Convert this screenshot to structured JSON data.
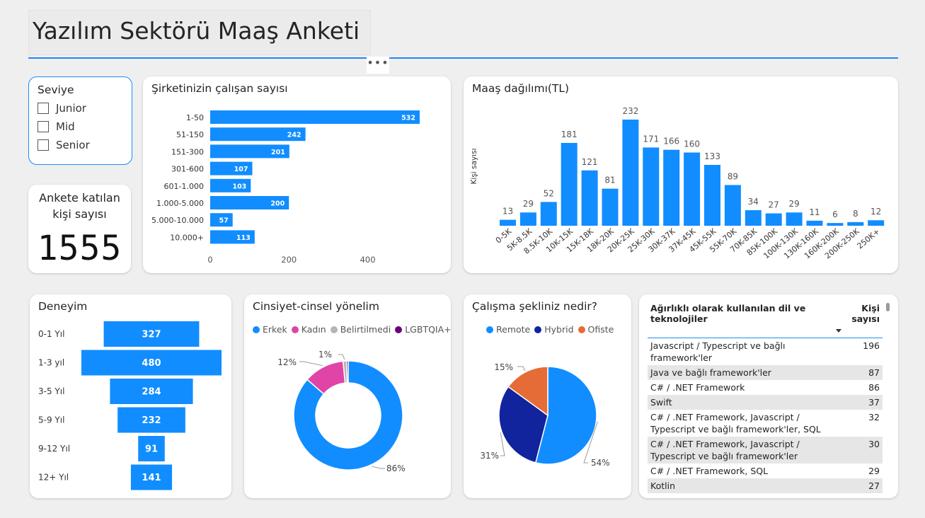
{
  "page_title": "Yazılım Sektörü Maaş Anketi",
  "more_label": "•••",
  "colors": {
    "blue": "#118DFF",
    "navy": "#12239E",
    "orange": "#E66C37",
    "pink": "#E044A7",
    "gray": "#b5b5b5",
    "purple": "#6B007B",
    "accent": "#1e8af5"
  },
  "slicer": {
    "title": "Seviye",
    "items": [
      "Junior",
      "Mid",
      "Senior"
    ]
  },
  "kpi": {
    "label": "Ankete katılan kişi sayısı",
    "value": "1555"
  },
  "chart_data": [
    {
      "id": "company_size",
      "type": "bar",
      "orientation": "horizontal",
      "title": "Şirketinizin çalışan sayısı",
      "categories": [
        "1-50",
        "51-150",
        "151-300",
        "301-600",
        "601-1.000",
        "1.000-5.000",
        "5.000-10.000",
        "10.000+"
      ],
      "values": [
        532,
        242,
        201,
        107,
        103,
        200,
        57,
        113
      ],
      "xticks": [
        0,
        200,
        400
      ],
      "xlim": [
        0,
        500
      ],
      "color": "#118DFF"
    },
    {
      "id": "salary",
      "type": "bar",
      "title": "Maaş dağılımı(TL)",
      "ylabel": "Kişi sayısı",
      "categories": [
        "0-5K",
        "5K-8.5K",
        "8.5K-10K",
        "10K-15K",
        "15K-18K",
        "18K-20K",
        "20K-25K",
        "25K-30K",
        "30K-37K",
        "37K-45K",
        "45K-55K",
        "55K-70K",
        "70K-85K",
        "85K-100K",
        "100K-130K",
        "130K-160K",
        "160K-200K",
        "200K-250K",
        "250K+"
      ],
      "values": [
        13,
        29,
        52,
        181,
        121,
        81,
        232,
        171,
        166,
        160,
        133,
        89,
        34,
        27,
        29,
        11,
        6,
        8,
        12
      ],
      "color": "#118DFF"
    },
    {
      "id": "experience",
      "type": "bar",
      "subtype": "funnel",
      "title": "Deneyim",
      "categories": [
        "0-1 Yıl",
        "1-3 yıl",
        "3-5 Yıl",
        "5-9 Yıl",
        "9-12 Yıl",
        "12+ Yıl"
      ],
      "values": [
        327,
        480,
        284,
        232,
        91,
        141
      ],
      "color": "#118DFF"
    },
    {
      "id": "gender",
      "type": "pie",
      "subtype": "donut",
      "title": "Cinsiyet-cinsel yönelim",
      "categories": [
        "Erkek",
        "Kadın",
        "Belirtilmedi",
        "LGBTQIA+"
      ],
      "values": [
        86,
        12,
        1,
        0.5
      ],
      "labels": [
        "86%",
        "12%",
        "1%",
        ""
      ],
      "colors": [
        "#118DFF",
        "#E044A7",
        "#b5b5b5",
        "#6B007B"
      ],
      "legend": "top"
    },
    {
      "id": "work_mode",
      "type": "pie",
      "title": "Çalışma şekliniz nedir?",
      "categories": [
        "Remote",
        "Hybrid",
        "Ofiste"
      ],
      "values": [
        54,
        31,
        15
      ],
      "labels": [
        "54%",
        "31%",
        "15%"
      ],
      "colors": [
        "#118DFF",
        "#12239E",
        "#E66C37"
      ],
      "legend": "top"
    },
    {
      "id": "tech",
      "type": "table",
      "columns": [
        "Ağırlıklı olarak kullanılan dil ve teknolojiler",
        "Kişi sayısı"
      ],
      "sort_icon": "sort-down-icon",
      "rows": [
        [
          "Javascript / Typescript ve bağlı framework'ler",
          196
        ],
        [
          "Java ve bağlı framework'ler",
          87
        ],
        [
          "C# / .NET Framework",
          86
        ],
        [
          "Swift",
          37
        ],
        [
          "C# / .NET Framework, Javascript / Typescript ve bağlı framework'ler, SQL",
          32
        ],
        [
          "C# / .NET Framework, Javascript / Typescript ve bağlı framework'ler",
          30
        ],
        [
          "C# / .NET Framework, SQL",
          29
        ],
        [
          "Kotlin",
          27
        ]
      ]
    }
  ]
}
